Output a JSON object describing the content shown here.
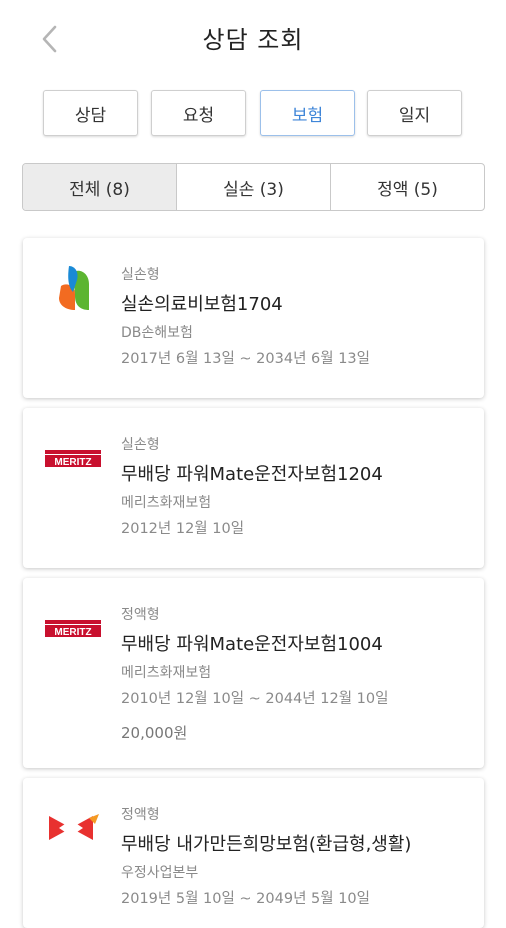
{
  "header": {
    "title": "상담 조회"
  },
  "category_tabs": [
    {
      "label": "상담",
      "active": false
    },
    {
      "label": "요청",
      "active": false
    },
    {
      "label": "보험",
      "active": true
    },
    {
      "label": "일지",
      "active": false
    }
  ],
  "filter_tabs": [
    {
      "label": "전체 (8)",
      "active": true
    },
    {
      "label": "실손 (3)",
      "active": false
    },
    {
      "label": "정액 (5)",
      "active": false
    }
  ],
  "policies": [
    {
      "logo": "db-insurance-logo",
      "type": "실손형",
      "name": "실손의료비보험1704",
      "company": "DB손해보험",
      "period": "2017년 6월 13일 ~ 2034년 6월 13일",
      "amount": ""
    },
    {
      "logo": "meritz-logo",
      "type": "실손형",
      "name": "무배당 파워Mate운전자보험1204",
      "company": "메리츠화재보험",
      "period": "2012년 12월 10일",
      "amount": ""
    },
    {
      "logo": "meritz-logo",
      "type": "정액형",
      "name": "무배당 파워Mate운전자보험1004",
      "company": "메리츠화재보험",
      "period": "2010년 12월 10일 ~ 2044년 12월 10일",
      "amount": "20,000원"
    },
    {
      "logo": "korea-post-logo",
      "type": "정액형",
      "name": "무배당 내가만든희망보험(환급형,생활)",
      "company": "우정사업본부",
      "period": "2019년 5월 10일 ~ 2049년 5월 10일",
      "amount": ""
    }
  ],
  "colors": {
    "accent": "#3f86d8",
    "meritz_red": "#c8102e",
    "post_red": "#e8312f",
    "db_orange": "#f26b21",
    "db_blue": "#1a8ad6",
    "db_green": "#5cb531"
  }
}
